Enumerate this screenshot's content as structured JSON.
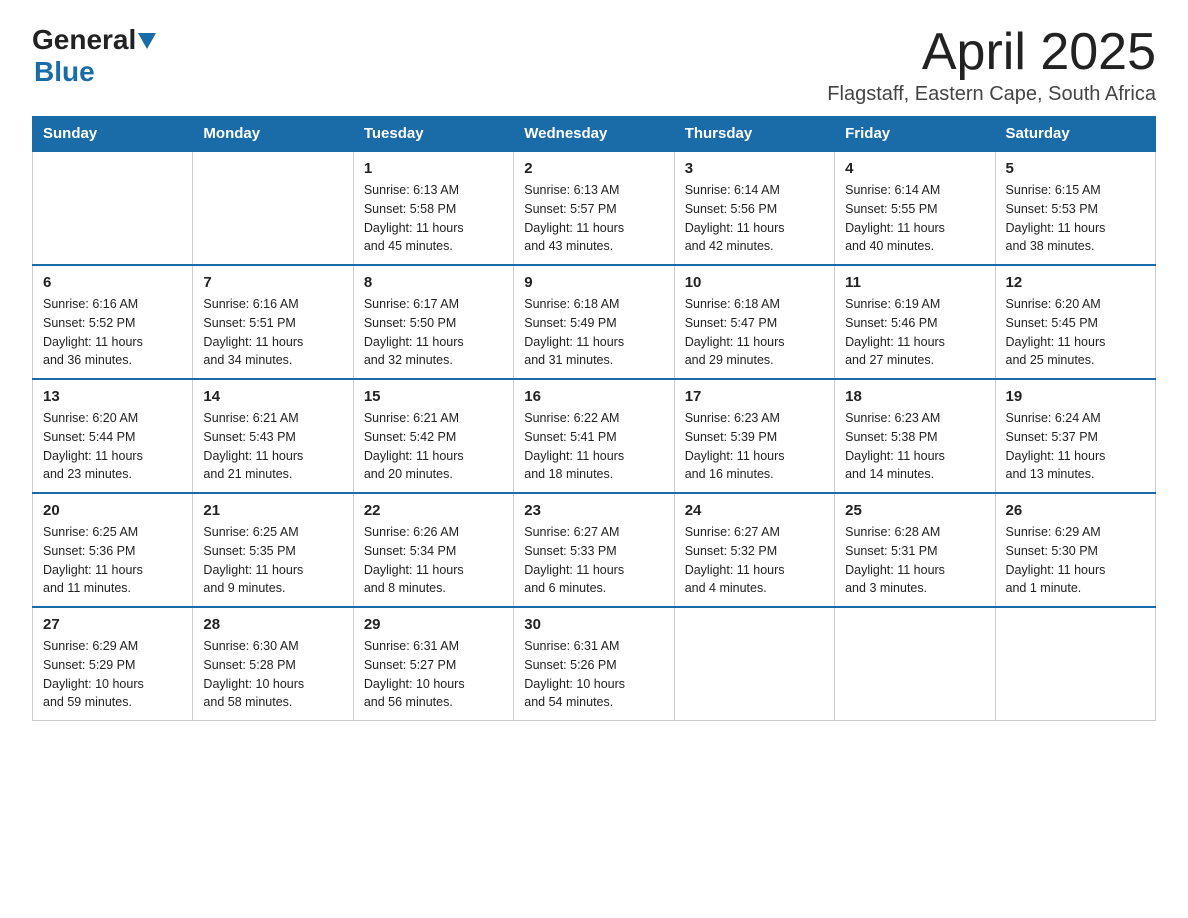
{
  "header": {
    "logo_general": "General",
    "logo_blue": "Blue",
    "title": "April 2025",
    "location": "Flagstaff, Eastern Cape, South Africa"
  },
  "calendar": {
    "days_of_week": [
      "Sunday",
      "Monday",
      "Tuesday",
      "Wednesday",
      "Thursday",
      "Friday",
      "Saturday"
    ],
    "weeks": [
      [
        {
          "day": "",
          "info": ""
        },
        {
          "day": "",
          "info": ""
        },
        {
          "day": "1",
          "info": "Sunrise: 6:13 AM\nSunset: 5:58 PM\nDaylight: 11 hours\nand 45 minutes."
        },
        {
          "day": "2",
          "info": "Sunrise: 6:13 AM\nSunset: 5:57 PM\nDaylight: 11 hours\nand 43 minutes."
        },
        {
          "day": "3",
          "info": "Sunrise: 6:14 AM\nSunset: 5:56 PM\nDaylight: 11 hours\nand 42 minutes."
        },
        {
          "day": "4",
          "info": "Sunrise: 6:14 AM\nSunset: 5:55 PM\nDaylight: 11 hours\nand 40 minutes."
        },
        {
          "day": "5",
          "info": "Sunrise: 6:15 AM\nSunset: 5:53 PM\nDaylight: 11 hours\nand 38 minutes."
        }
      ],
      [
        {
          "day": "6",
          "info": "Sunrise: 6:16 AM\nSunset: 5:52 PM\nDaylight: 11 hours\nand 36 minutes."
        },
        {
          "day": "7",
          "info": "Sunrise: 6:16 AM\nSunset: 5:51 PM\nDaylight: 11 hours\nand 34 minutes."
        },
        {
          "day": "8",
          "info": "Sunrise: 6:17 AM\nSunset: 5:50 PM\nDaylight: 11 hours\nand 32 minutes."
        },
        {
          "day": "9",
          "info": "Sunrise: 6:18 AM\nSunset: 5:49 PM\nDaylight: 11 hours\nand 31 minutes."
        },
        {
          "day": "10",
          "info": "Sunrise: 6:18 AM\nSunset: 5:47 PM\nDaylight: 11 hours\nand 29 minutes."
        },
        {
          "day": "11",
          "info": "Sunrise: 6:19 AM\nSunset: 5:46 PM\nDaylight: 11 hours\nand 27 minutes."
        },
        {
          "day": "12",
          "info": "Sunrise: 6:20 AM\nSunset: 5:45 PM\nDaylight: 11 hours\nand 25 minutes."
        }
      ],
      [
        {
          "day": "13",
          "info": "Sunrise: 6:20 AM\nSunset: 5:44 PM\nDaylight: 11 hours\nand 23 minutes."
        },
        {
          "day": "14",
          "info": "Sunrise: 6:21 AM\nSunset: 5:43 PM\nDaylight: 11 hours\nand 21 minutes."
        },
        {
          "day": "15",
          "info": "Sunrise: 6:21 AM\nSunset: 5:42 PM\nDaylight: 11 hours\nand 20 minutes."
        },
        {
          "day": "16",
          "info": "Sunrise: 6:22 AM\nSunset: 5:41 PM\nDaylight: 11 hours\nand 18 minutes."
        },
        {
          "day": "17",
          "info": "Sunrise: 6:23 AM\nSunset: 5:39 PM\nDaylight: 11 hours\nand 16 minutes."
        },
        {
          "day": "18",
          "info": "Sunrise: 6:23 AM\nSunset: 5:38 PM\nDaylight: 11 hours\nand 14 minutes."
        },
        {
          "day": "19",
          "info": "Sunrise: 6:24 AM\nSunset: 5:37 PM\nDaylight: 11 hours\nand 13 minutes."
        }
      ],
      [
        {
          "day": "20",
          "info": "Sunrise: 6:25 AM\nSunset: 5:36 PM\nDaylight: 11 hours\nand 11 minutes."
        },
        {
          "day": "21",
          "info": "Sunrise: 6:25 AM\nSunset: 5:35 PM\nDaylight: 11 hours\nand 9 minutes."
        },
        {
          "day": "22",
          "info": "Sunrise: 6:26 AM\nSunset: 5:34 PM\nDaylight: 11 hours\nand 8 minutes."
        },
        {
          "day": "23",
          "info": "Sunrise: 6:27 AM\nSunset: 5:33 PM\nDaylight: 11 hours\nand 6 minutes."
        },
        {
          "day": "24",
          "info": "Sunrise: 6:27 AM\nSunset: 5:32 PM\nDaylight: 11 hours\nand 4 minutes."
        },
        {
          "day": "25",
          "info": "Sunrise: 6:28 AM\nSunset: 5:31 PM\nDaylight: 11 hours\nand 3 minutes."
        },
        {
          "day": "26",
          "info": "Sunrise: 6:29 AM\nSunset: 5:30 PM\nDaylight: 11 hours\nand 1 minute."
        }
      ],
      [
        {
          "day": "27",
          "info": "Sunrise: 6:29 AM\nSunset: 5:29 PM\nDaylight: 10 hours\nand 59 minutes."
        },
        {
          "day": "28",
          "info": "Sunrise: 6:30 AM\nSunset: 5:28 PM\nDaylight: 10 hours\nand 58 minutes."
        },
        {
          "day": "29",
          "info": "Sunrise: 6:31 AM\nSunset: 5:27 PM\nDaylight: 10 hours\nand 56 minutes."
        },
        {
          "day": "30",
          "info": "Sunrise: 6:31 AM\nSunset: 5:26 PM\nDaylight: 10 hours\nand 54 minutes."
        },
        {
          "day": "",
          "info": ""
        },
        {
          "day": "",
          "info": ""
        },
        {
          "day": "",
          "info": ""
        }
      ]
    ]
  }
}
